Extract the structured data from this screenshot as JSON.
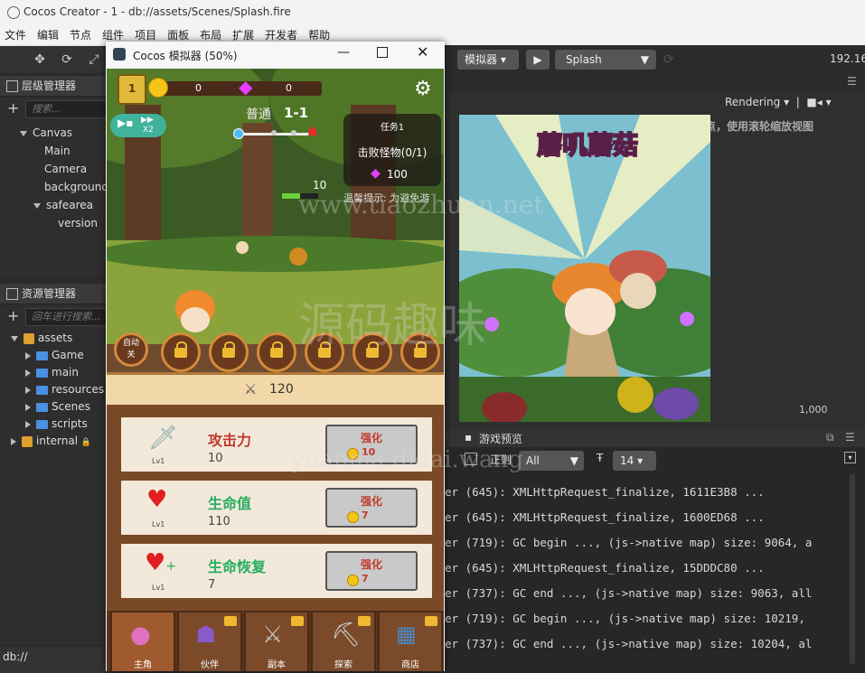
{
  "window": {
    "title": "Cocos Creator - 1 - db://assets/Scenes/Splash.fire"
  },
  "menu": [
    "文件",
    "编辑",
    "节点",
    "组件",
    "项目",
    "面板",
    "布局",
    "扩展",
    "开发者",
    "帮助"
  ],
  "hierarchy": {
    "title": "层级管理器",
    "search_placeholder": "搜索...",
    "nodes": [
      "Canvas",
      "Main Camera",
      "background",
      "safearea",
      "version"
    ]
  },
  "assets": {
    "title": "资源管理器",
    "search_placeholder": "回车进行搜索...",
    "root": "assets",
    "folders": [
      "Game",
      "main",
      "resources",
      "Scenes",
      "scripts"
    ],
    "internal": "internal"
  },
  "status_bar": {
    "path": "db://"
  },
  "simulator": {
    "title": "Cocos 模拟器 (50%)",
    "level_badge": "1",
    "coins": "0",
    "gems": "0",
    "speed_label": "X2",
    "stage_mode": "普通",
    "stage": "1-1",
    "task_title": "任务1",
    "task_desc": "击败怪物(0/1)",
    "task_reward": "100",
    "hp_value": "10",
    "tip": "温馨提示: 为避免游",
    "auto_button": "自动\n关",
    "power": "120",
    "upgrades": [
      {
        "name": "攻击力",
        "value": "10",
        "level": "Lv1",
        "btn": "强化",
        "cost": "10",
        "color": "#c0392b"
      },
      {
        "name": "生命值",
        "value": "110",
        "level": "Lv1",
        "btn": "强化",
        "cost": "7",
        "color": "#27ae60"
      },
      {
        "name": "生命恢复",
        "value": "7",
        "level": "Lv1",
        "btn": "强化",
        "cost": "7",
        "color": "#27ae60"
      }
    ],
    "nav": [
      "主角",
      "伙伴",
      "副本",
      "探索",
      "商店"
    ]
  },
  "scene_toolbar": {
    "simulator_label": "模拟器",
    "scene_select": "Splash",
    "ip": "192.168"
  },
  "scene_view": {
    "render_label": "Rendering",
    "hint": "按住空格平移视窗焦点，使用滚轮缩放视图",
    "splash_title": "蘑叽蘑菇",
    "axis_label": "1,000"
  },
  "console": {
    "title": "游戏预览",
    "regex_label": "正则",
    "filter": "All",
    "font_size": "14",
    "lines": [
      "er (645): XMLHttpRequest_finalize, 1611E3B8 ...",
      "er (645): XMLHttpRequest_finalize, 1600ED68 ...",
      "er (719): GC begin ..., (js->native map) size: 9064, a",
      "er (645): XMLHttpRequest_finalize, 15DDDC80 ...",
      "er (737): GC end ..., (js->native map) size: 9063, all",
      "er (719): GC begin ..., (js->native map) size: 10219,",
      "er (737): GC end ..., (js->native map) size: 10204, al"
    ]
  },
  "watermarks": [
    "www.tiaozhuan.net",
    "源码趣味",
    "yuanma.didai.wang"
  ]
}
